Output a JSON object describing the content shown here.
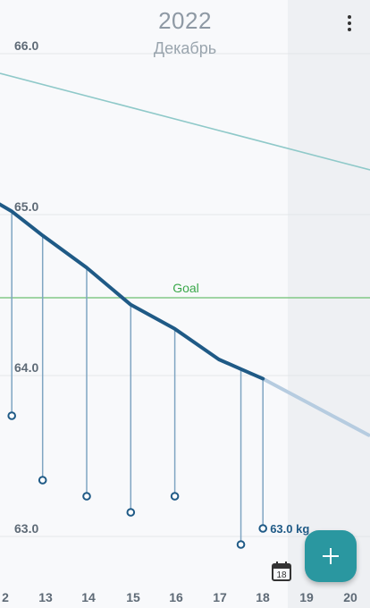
{
  "header": {
    "year": "2022",
    "month": "Декабрь"
  },
  "goal_label": "Goal",
  "fab_icon": "plus-icon",
  "calendar_day": "18",
  "menu_icon": "more-vert-icon",
  "colors": {
    "trend_line": "#1f5a86",
    "trend_forecast": "#b6cce0",
    "target_line": "#8fc9c9",
    "goal_line": "#6cc070",
    "marker": "#1f5a86",
    "accent": "#2a97a0"
  },
  "chart_data": {
    "type": "line",
    "x_ticks": [
      "2",
      "13",
      "14",
      "15",
      "16",
      "17",
      "18",
      "19",
      "20"
    ],
    "y_ticks": [
      "66.0",
      "65.0",
      "64.0",
      "63.0"
    ],
    "goal": 64.5,
    "target_line": [
      [
        11.8,
        65.85
      ],
      [
        20.0,
        65.22
      ]
    ],
    "trend": [
      [
        11.8,
        65.05
      ],
      [
        12.3,
        64.97
      ],
      [
        13,
        64.82
      ],
      [
        14,
        64.62
      ],
      [
        15,
        64.39
      ],
      [
        16,
        64.24
      ],
      [
        17,
        64.05
      ],
      [
        17.5,
        63.99
      ],
      [
        18,
        63.93
      ]
    ],
    "trend_forecast": [
      [
        18,
        63.93
      ],
      [
        20.4,
        63.58
      ]
    ],
    "measurements": [
      {
        "x": 12.3,
        "y": 63.7
      },
      {
        "x": 13,
        "y": 63.3
      },
      {
        "x": 14,
        "y": 63.2
      },
      {
        "x": 15,
        "y": 63.1
      },
      {
        "x": 16,
        "y": 63.2
      },
      {
        "x": 17.5,
        "y": 62.9
      },
      {
        "x": 18,
        "y": 63.0
      }
    ],
    "last_value_label": "63.0 kg"
  }
}
